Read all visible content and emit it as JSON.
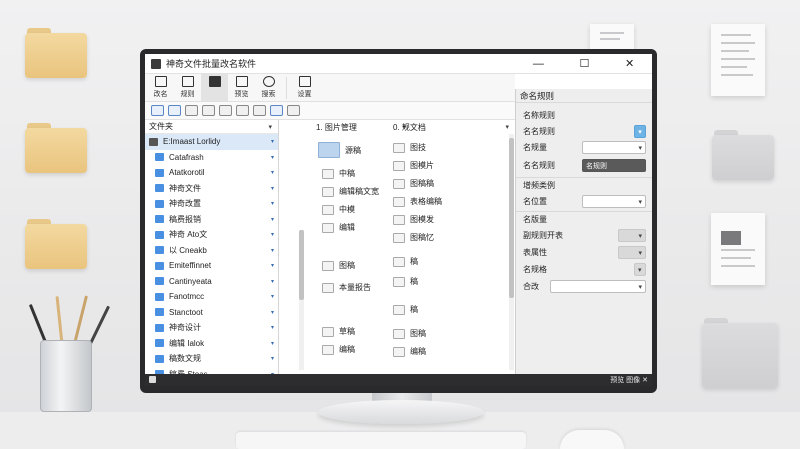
{
  "window": {
    "title": "神奇文件批量改名软件",
    "controls": [
      "—",
      "☐",
      "✕"
    ]
  },
  "ribbon": [
    {
      "label": "改名",
      "icon": "rename-icon"
    },
    {
      "label": "规则",
      "icon": "rules-icon"
    },
    {
      "label": "",
      "icon": "document-icon",
      "active": true
    },
    {
      "label": "预览",
      "icon": "preview-icon"
    },
    {
      "label": "搜索",
      "icon": "search-icon"
    },
    {
      "label": "设置",
      "icon": "settings-icon"
    }
  ],
  "tree": {
    "header": "文件夹",
    "root": "E:Imaast Lorlidy",
    "items": [
      "Catafrash",
      "Atatkorotil",
      "神奇文件",
      "神奇改置",
      "稿费报销",
      "神奇 Ato文",
      "以 Cneakb",
      "Emiteffinnet",
      "Cantinyeata",
      "Fanotmcc",
      "Stanctoot",
      "神奇设计",
      "编辑 Ialok",
      "稿数文规",
      "稿费 Stoas"
    ]
  },
  "columns": {
    "left": {
      "header": "1. 图片管理",
      "files": [
        "源稿",
        "中稿",
        "编辑稿文宽",
        "中模",
        "编辑",
        "图稿",
        "本量报告",
        "草稿",
        "编稿"
      ]
    },
    "right": {
      "header": "0. 规文档",
      "files": [
        "图技",
        "图模片",
        "图稿稿",
        "表格编稿",
        "图模发",
        "图稿忆",
        "稿",
        "稿",
        "稿",
        "图稿",
        "编稿"
      ]
    }
  },
  "props": {
    "title": "命名规则",
    "rows": [
      {
        "label": "名称规则",
        "control": "none"
      },
      {
        "label": "名名规则",
        "control": "blue",
        "value": "▾"
      },
      {
        "label": "名规量",
        "control": "dropdown",
        "value": ""
      },
      {
        "label": "名名规则",
        "control": "dark",
        "value": "名规则"
      },
      {
        "label": "增频类例",
        "control": "none"
      },
      {
        "label": "名位置",
        "control": "dropdown",
        "value": ""
      },
      {
        "label": "名版量",
        "control": "none"
      },
      {
        "label": "副规则开表",
        "control": "gray",
        "value": ""
      },
      {
        "label": "表属性",
        "control": "gray",
        "value": ""
      },
      {
        "label": "名规格",
        "control": "gray",
        "value": ""
      },
      {
        "label": "合改",
        "control": "dropdown",
        "value": ""
      }
    ]
  },
  "statusbar": {
    "left": "",
    "right": "预览 图像 ✕"
  },
  "colors": {
    "accent": "#4a90e2",
    "selection": "#dbe8f8",
    "statusbar": "#2d2d2f"
  }
}
